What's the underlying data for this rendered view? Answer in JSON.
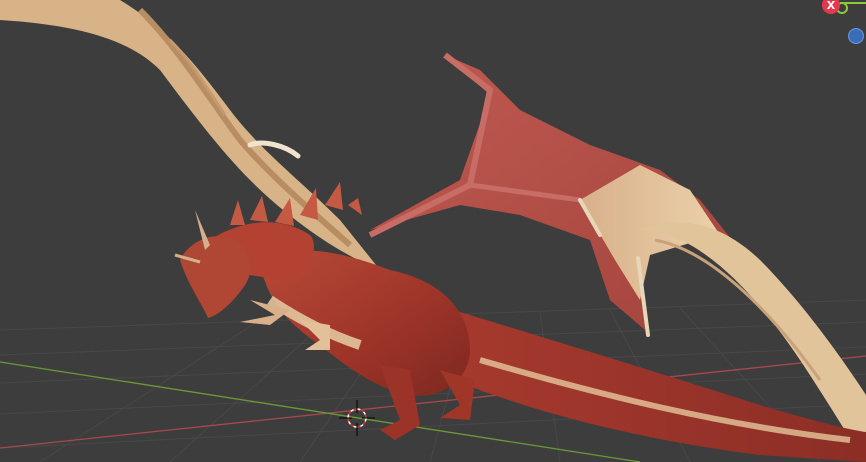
{
  "viewport": {
    "background_color": "#3d3d3d",
    "grid_color": "#4a4a4a",
    "x_axis_color": "#a8484d",
    "y_axis_color": "#6a9a36"
  },
  "gizmo": {
    "x_label": "X",
    "x_color": "#e5384f",
    "y_color": "#8acb3c",
    "z_color": "#3a6cb8"
  },
  "icons": {
    "cursor": "3d-cursor-icon"
  },
  "model": {
    "body_color": "#a8382c",
    "wing_membrane_color": "#b4504a",
    "belly_color": "#e6c79c"
  }
}
